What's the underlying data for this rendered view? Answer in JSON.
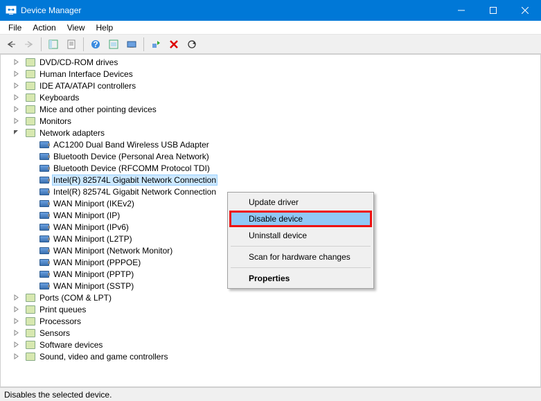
{
  "titlebar": {
    "title": "Device Manager"
  },
  "menubar": {
    "items": [
      "File",
      "Action",
      "View",
      "Help"
    ]
  },
  "statusbar": {
    "text": "Disables the selected device."
  },
  "tree": {
    "categories": [
      {
        "label": "DVD/CD-ROM drives",
        "expanded": false
      },
      {
        "label": "Human Interface Devices",
        "expanded": false
      },
      {
        "label": "IDE ATA/ATAPI controllers",
        "expanded": false
      },
      {
        "label": "Keyboards",
        "expanded": false
      },
      {
        "label": "Mice and other pointing devices",
        "expanded": false
      },
      {
        "label": "Monitors",
        "expanded": false
      },
      {
        "label": "Network adapters",
        "expanded": true,
        "children": [
          "AC1200  Dual Band Wireless USB Adapter",
          "Bluetooth Device (Personal Area Network)",
          "Bluetooth Device (RFCOMM Protocol TDI)",
          "Intel(R) 82574L Gigabit Network Connection",
          "Intel(R) 82574L Gigabit Network Connection",
          "WAN Miniport (IKEv2)",
          "WAN Miniport (IP)",
          "WAN Miniport (IPv6)",
          "WAN Miniport (L2TP)",
          "WAN Miniport (Network Monitor)",
          "WAN Miniport (PPPOE)",
          "WAN Miniport (PPTP)",
          "WAN Miniport (SSTP)"
        ],
        "selectedIndex": 3
      },
      {
        "label": "Ports (COM & LPT)",
        "expanded": false
      },
      {
        "label": "Print queues",
        "expanded": false
      },
      {
        "label": "Processors",
        "expanded": false
      },
      {
        "label": "Sensors",
        "expanded": false
      },
      {
        "label": "Software devices",
        "expanded": false
      },
      {
        "label": "Sound, video and game controllers",
        "expanded": false
      }
    ]
  },
  "context_menu": {
    "items": [
      {
        "label": "Update driver"
      },
      {
        "label": "Disable device",
        "active": true
      },
      {
        "label": "Uninstall device"
      },
      {
        "sep": true
      },
      {
        "label": "Scan for hardware changes"
      },
      {
        "sep": true
      },
      {
        "label": "Properties",
        "bold": true
      }
    ]
  }
}
